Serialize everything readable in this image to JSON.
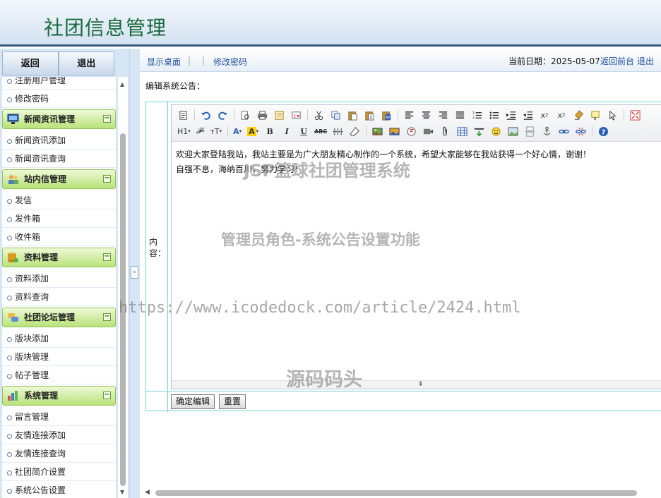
{
  "header": {
    "title": "社团信息管理"
  },
  "sidebar": {
    "back_label": "返回",
    "logout_label": "退出",
    "groups": [
      {
        "label": null,
        "items": [
          "注册用户管理",
          "修改密码"
        ]
      },
      {
        "label": "新闻资讯管理",
        "icon": "monitor-icon",
        "items": [
          "新闻资讯添加",
          "新闻资讯查询"
        ]
      },
      {
        "label": "站内信管理",
        "icon": "people-icon",
        "items": [
          "发信",
          "发件箱",
          "收件箱"
        ]
      },
      {
        "label": "资料管理",
        "icon": "database-icon",
        "items": [
          "资料添加",
          "资料查询"
        ]
      },
      {
        "label": "社团论坛管理",
        "icon": "forum-icon",
        "items": [
          "版块添加",
          "版块管理",
          "帖子管理"
        ]
      },
      {
        "label": "系统管理",
        "icon": "chart-icon",
        "items": [
          "留言管理",
          "友情连接添加",
          "友情连接查询",
          "社团简介设置",
          "系统公告设置"
        ]
      }
    ]
  },
  "topnav": {
    "show_desktop": "显示桌面",
    "change_password": "修改密码",
    "date_label": "当前日期：2025-05-07",
    "back_front": "返回前台",
    "logout": "退出"
  },
  "form": {
    "section_label": "编辑系统公告：",
    "content_label": "内容：",
    "submit_label": "确定编辑",
    "reset_label": "重置"
  },
  "editor": {
    "line1": "欢迎大家登陆我站，我站主要是为广大朋友精心制作的一个系统，希望大家能够在我站获得一个好心情，谢谢！",
    "line2": "自强不息，海纳百川，努力学习！",
    "heading_btn": "H1",
    "font_btn": "𝓕",
    "size_btn": "тT"
  },
  "watermarks": {
    "w1": "JSP篮球社团管理系统",
    "w2": "管理员角色-系统公告设置功能",
    "w3": "https://www.icodedock.com/article/2424.html",
    "w4": "源码码头"
  }
}
